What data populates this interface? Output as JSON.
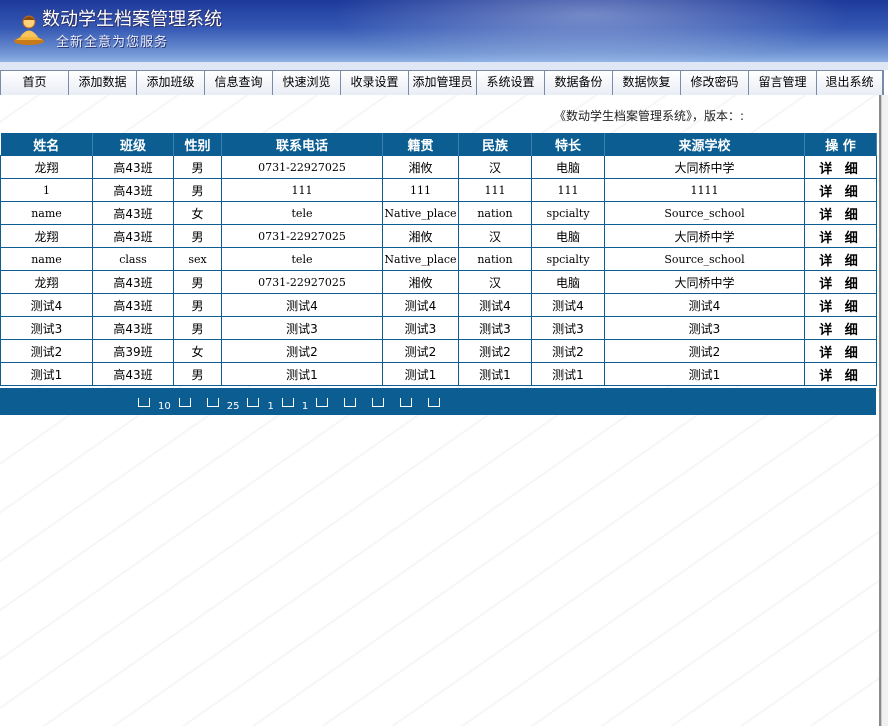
{
  "header": {
    "title": "数动学生档案管理系统",
    "subtitle": "全新全意为您服务"
  },
  "nav": [
    {
      "label": "首页",
      "w": 68
    },
    {
      "label": "添加数据",
      "w": 68
    },
    {
      "label": "添加班级",
      "w": 68
    },
    {
      "label": "信息查询",
      "w": 68
    },
    {
      "label": "快速浏览",
      "w": 68
    },
    {
      "label": "收录设置",
      "w": 68
    },
    {
      "label": "添加管理员",
      "w": 68
    },
    {
      "label": "系统设置",
      "w": 68
    },
    {
      "label": "数据备份",
      "w": 68
    },
    {
      "label": "数据恢复",
      "w": 68
    },
    {
      "label": "修改密码",
      "w": 68
    },
    {
      "label": "留言管理",
      "w": 68
    },
    {
      "label": "退出系统",
      "w": 66
    }
  ],
  "version_text": "《数动学生档案管理系统》，版本：:",
  "table": {
    "columns": [
      "姓名",
      "班级",
      "性别",
      "联系电话",
      "籍贯",
      "民族",
      "特长",
      "来源学校",
      "操 作"
    ],
    "rows": [
      [
        "龙翔",
        "高43班",
        "男",
        "0731-22927025",
        "湘攸",
        "汉",
        "电脑",
        "大同桥中学",
        "详 细"
      ],
      [
        "1",
        "高43班",
        "男",
        "111",
        "111",
        "111",
        "111",
        "1111",
        "详 细"
      ],
      [
        "name",
        "高43班",
        "女",
        "tele",
        "Native_place",
        "nation",
        "spcialty",
        "Source_school",
        "详 细"
      ],
      [
        "龙翔",
        "高43班",
        "男",
        "0731-22927025",
        "湘攸",
        "汉",
        "电脑",
        "大同桥中学",
        "详 细"
      ],
      [
        "name",
        "class",
        "sex",
        "tele",
        "Native_place",
        "nation",
        "spcialty",
        "Source_school",
        "详 细"
      ],
      [
        "龙翔",
        "高43班",
        "男",
        "0731-22927025",
        "湘攸",
        "汉",
        "电脑",
        "大同桥中学",
        "详 细"
      ],
      [
        "测试4",
        "高43班",
        "男",
        "测试4",
        "测试4",
        "测试4",
        "测试4",
        "测试4",
        "详 细"
      ],
      [
        "测试3",
        "高43班",
        "男",
        "测试3",
        "测试3",
        "测试3",
        "测试3",
        "测试3",
        "详 细"
      ],
      [
        "测试2",
        "高39班",
        "女",
        "测试2",
        "测试2",
        "测试2",
        "测试2",
        "测试2",
        "详 细"
      ],
      [
        "测试1",
        "高43班",
        "男",
        "测试1",
        "测试1",
        "测试1",
        "测试1",
        "测试1",
        "详 细"
      ]
    ]
  },
  "pager": {
    "per_page": "10",
    "total": "25",
    "current_page": "1",
    "total_pages": "1"
  }
}
